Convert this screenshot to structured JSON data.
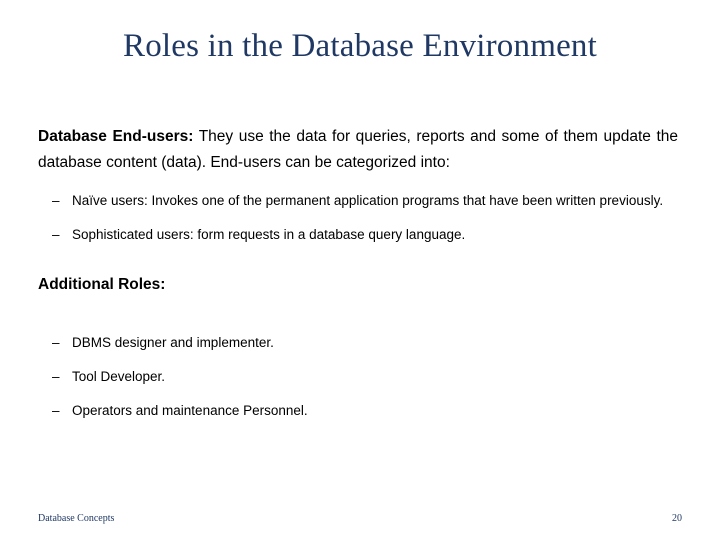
{
  "slide": {
    "title": "Roles in the Database Environment",
    "intro": {
      "lead": "Database End-users:",
      "text": " They use the data for queries, reports and some of them update the database content (data). End-users can be categorized into:"
    },
    "enduser_items": [
      {
        "dash": "–",
        "text": "Naïve users: Invokes one of the permanent application programs that have been written previously."
      },
      {
        "dash": "–",
        "text": "Sophisticated users: form requests in a database query language."
      }
    ],
    "additional_heading": "Additional Roles:",
    "additional_items": [
      {
        "dash": "–",
        "text": "DBMS designer and implementer."
      },
      {
        "dash": "–",
        "text": "Tool Developer."
      },
      {
        "dash": "–",
        "text": "Operators and maintenance Personnel."
      }
    ],
    "footer": {
      "left": "Database Concepts",
      "right": "20"
    }
  }
}
